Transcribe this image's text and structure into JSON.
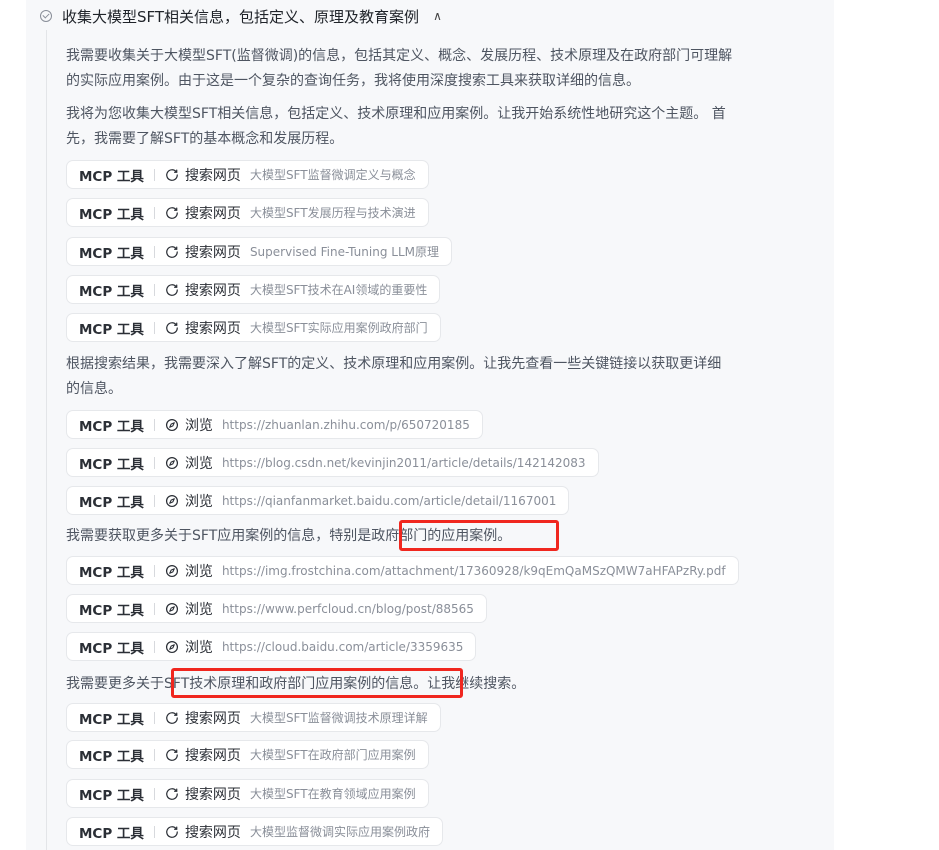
{
  "header": {
    "title": "收集大模型SFT相关信息，包括定义、原理及教育案例"
  },
  "paragraphs": [
    {
      "line1": "我需要收集关于大模型SFT(监督微调)的信息，包括其定义、概念、发展历程、技术原理及在政府部门可理解",
      "line2": "的实际应用案例。由于这是一个复杂的查询任务，我将使用深度搜索工具来获取详细的信息。"
    },
    {
      "line1": "我将为您收集大模型SFT相关信息，包括定义、技术原理和应用案例。让我开始系统性地研究这个主题。 首",
      "line2": "先，我需要了解SFT的基本概念和发展历程。"
    },
    {
      "line1": "根据搜索结果，我需要深入了解SFT的定义、技术原理和应用案例。让我先查看一些关键链接以获取更详细",
      "line2": "的信息。"
    },
    {
      "pre": "我需要获取更多关于SFT应用案例的信息，特别是",
      "hl": "政府部门的应用案例",
      "post": "。"
    },
    {
      "pre": "我需要更多关于",
      "hl": "SFT技术原理和政府部门应用案例的信息",
      "post": "。让我继续搜索。"
    }
  ],
  "tool_label": "MCP 工具",
  "actions": {
    "search": "搜索网页",
    "browse": "浏览"
  },
  "tool_calls": [
    {
      "action": "search",
      "icon": "search-refresh-icon",
      "arg": "大模型SFT监督微调定义与概念"
    },
    {
      "action": "search",
      "icon": "search-refresh-icon",
      "arg": "大模型SFT发展历程与技术演进"
    },
    {
      "action": "search",
      "icon": "search-refresh-icon",
      "arg": "Supervised Fine-Tuning LLM原理"
    },
    {
      "action": "search",
      "icon": "search-refresh-icon",
      "arg": "大模型SFT技术在AI领域的重要性"
    },
    {
      "action": "search",
      "icon": "search-refresh-icon",
      "arg": "大模型SFT实际应用案例政府部门"
    },
    {
      "action": "browse",
      "icon": "compass-icon",
      "arg": "https://zhuanlan.zhihu.com/p/650720185"
    },
    {
      "action": "browse",
      "icon": "compass-icon",
      "arg": "https://blog.csdn.net/kevinjin2011/article/details/142142083"
    },
    {
      "action": "browse",
      "icon": "compass-icon",
      "arg": "https://qianfanmarket.baidu.com/article/detail/1167001"
    },
    {
      "action": "browse",
      "icon": "compass-icon",
      "arg": "https://img.frostchina.com/attachment/17360928/k9qEmQaMSzQMW7aHFAPzRy.pdf"
    },
    {
      "action": "browse",
      "icon": "compass-icon",
      "arg": "https://www.perfcloud.cn/blog/post/88565"
    },
    {
      "action": "browse",
      "icon": "compass-icon",
      "arg": "https://cloud.baidu.com/article/3359635"
    },
    {
      "action": "search",
      "icon": "search-refresh-icon",
      "arg": "大模型SFT监督微调技术原理详解"
    },
    {
      "action": "search",
      "icon": "search-refresh-icon",
      "arg": "大模型SFT在政府部门应用案例"
    },
    {
      "action": "search",
      "icon": "search-refresh-icon",
      "arg": "大模型SFT在教育领域应用案例"
    },
    {
      "action": "search",
      "icon": "search-refresh-icon",
      "arg": "大模型监督微调实际应用案例政府"
    }
  ],
  "colors": {
    "highlight": "#f0271f",
    "panel": "#f7f8fa"
  }
}
